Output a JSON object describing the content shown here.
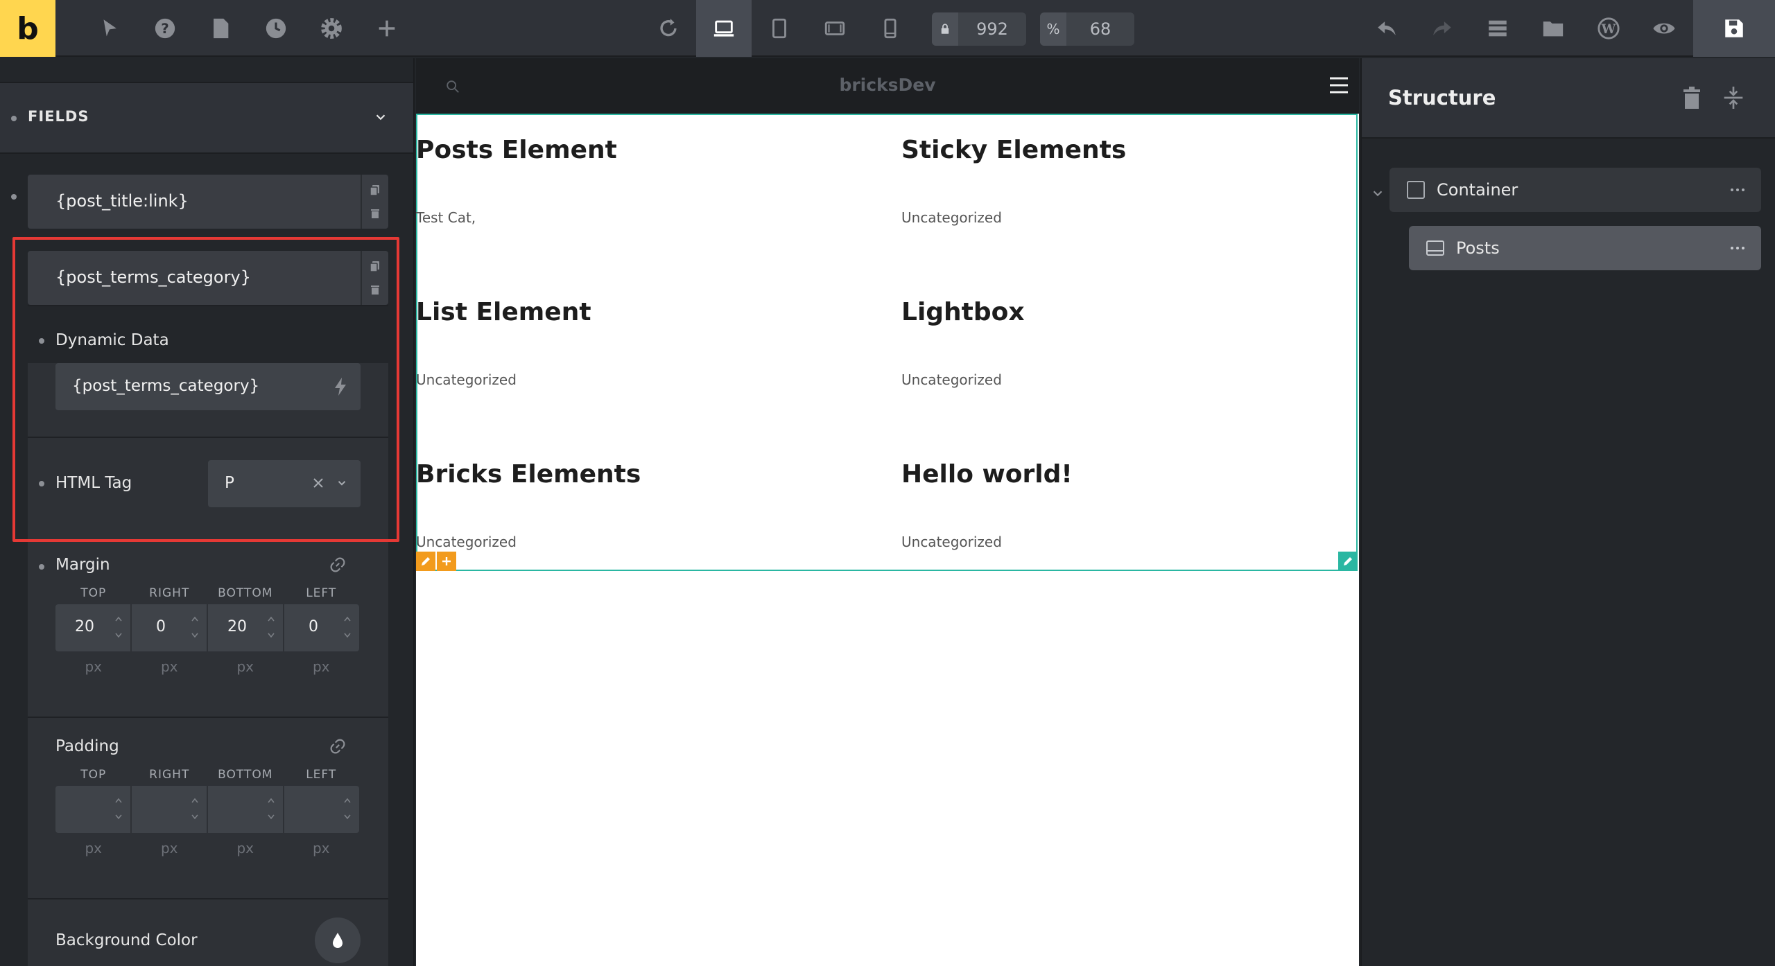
{
  "toolbar": {
    "logo": "b",
    "width_value": "992",
    "zoom_prefix": "%",
    "zoom_value": "68"
  },
  "left_panel": {
    "section_title": "FIELDS",
    "fields": [
      {
        "label": "{post_title:link}"
      },
      {
        "label": "{post_terms_category}"
      }
    ],
    "dynamic_data": {
      "label": "Dynamic Data",
      "value": "{post_terms_category}"
    },
    "html_tag": {
      "label": "HTML Tag",
      "value": "P"
    },
    "margin": {
      "label": "Margin",
      "sides": [
        "TOP",
        "RIGHT",
        "BOTTOM",
        "LEFT"
      ],
      "values": [
        "20",
        "0",
        "20",
        "0"
      ],
      "units": [
        "px",
        "px",
        "px",
        "px"
      ]
    },
    "padding": {
      "label": "Padding",
      "sides": [
        "TOP",
        "RIGHT",
        "BOTTOM",
        "LEFT"
      ],
      "values": [
        "",
        "",
        "",
        ""
      ],
      "units": [
        "px",
        "px",
        "px",
        "px"
      ]
    },
    "background_color": {
      "label": "Background Color"
    }
  },
  "canvas": {
    "site_name": "bricksDev",
    "posts": [
      {
        "title": "Posts Element",
        "category": "Test Cat,"
      },
      {
        "title": "Sticky Elements",
        "category": "Uncategorized"
      },
      {
        "title": "List Element",
        "category": "Uncategorized"
      },
      {
        "title": "Lightbox",
        "category": "Uncategorized"
      },
      {
        "title": "Bricks Elements",
        "category": "Uncategorized"
      },
      {
        "title": "Hello world!",
        "category": "Uncategorized"
      }
    ],
    "colors": {
      "selection": "#2ab7a2",
      "toolbar_accent": "#f29b1d"
    }
  },
  "right_panel": {
    "title": "Structure",
    "nodes": [
      {
        "label": "Container"
      },
      {
        "label": "Posts"
      }
    ]
  },
  "icons": [
    "pointer-icon",
    "help-icon",
    "page-icon",
    "history-icon",
    "settings-icon",
    "add-icon",
    "refresh-icon",
    "desktop-icon",
    "tablet-portrait-icon",
    "tablet-landscape-icon",
    "mobile-icon",
    "lock-icon",
    "undo-icon",
    "redo-icon",
    "templates-icon",
    "folder-icon",
    "wordpress-icon",
    "preview-icon",
    "save-icon"
  ]
}
